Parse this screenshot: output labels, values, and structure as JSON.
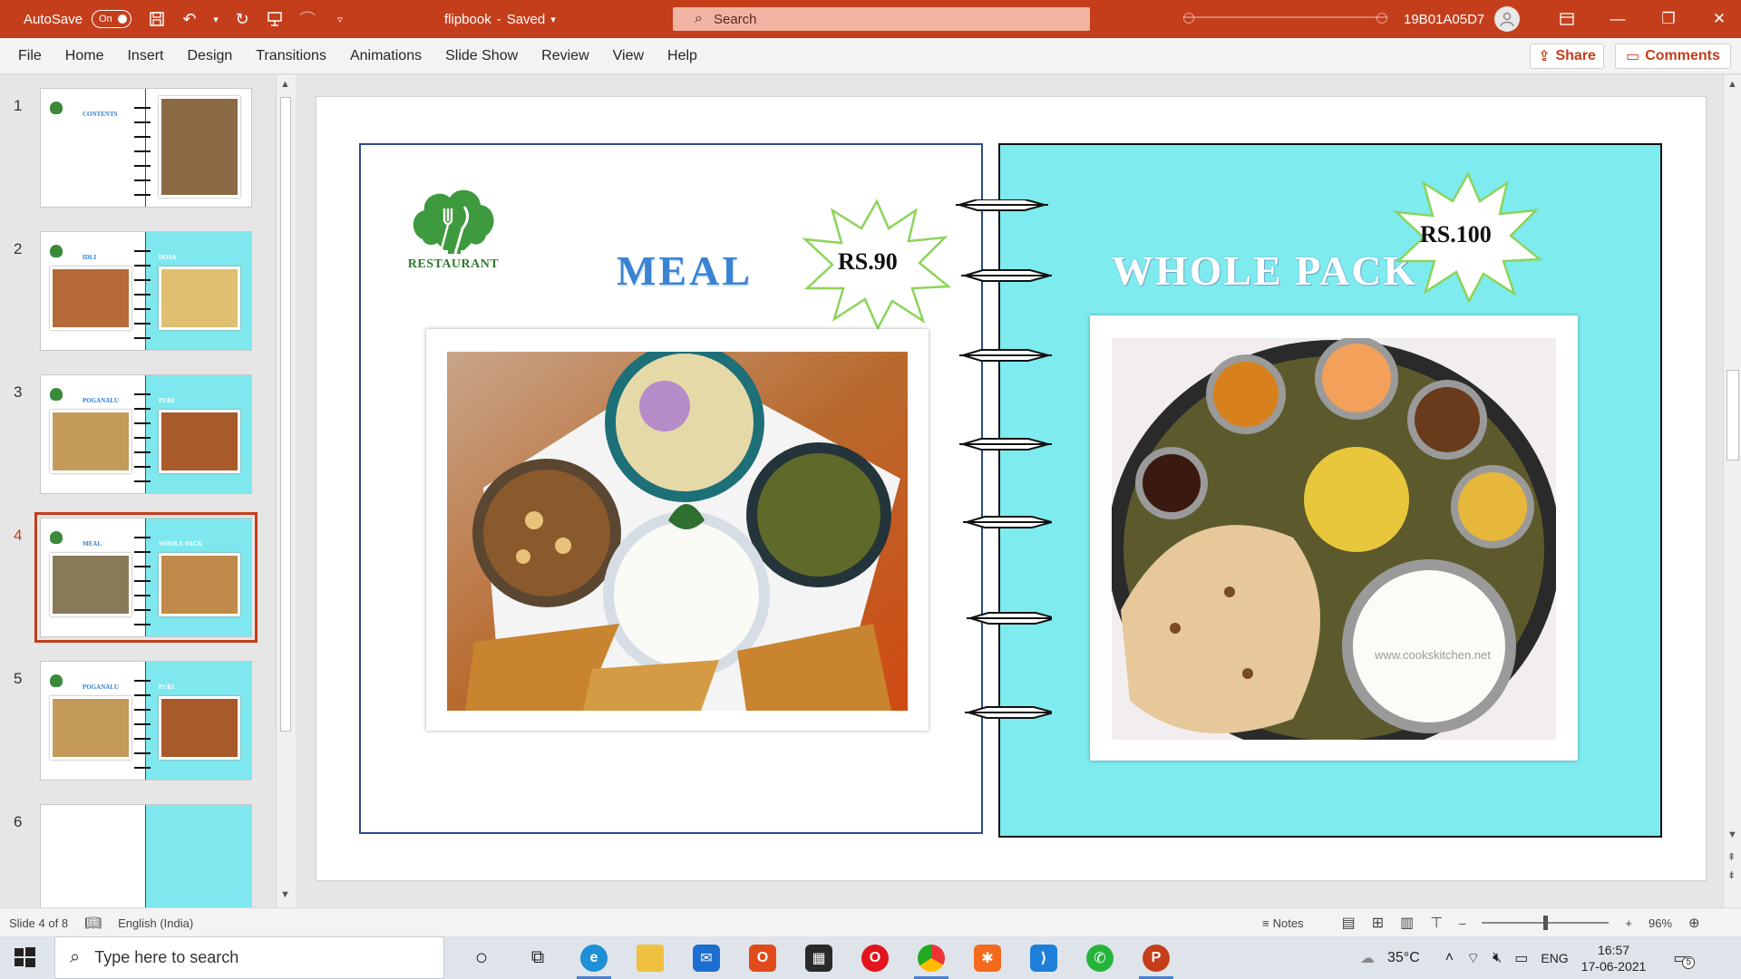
{
  "titlebar": {
    "autosave_label": "AutoSave",
    "autosave_state": "On",
    "filename": "flipbook",
    "saved_state": "Saved",
    "search_placeholder": "Search",
    "user_id": "19B01A05D7",
    "accent_color": "#c43e1c"
  },
  "menu": {
    "items": [
      "File",
      "Home",
      "Insert",
      "Design",
      "Transitions",
      "Animations",
      "Slide Show",
      "Review",
      "View",
      "Help"
    ],
    "share_label": "Share",
    "comments_label": "Comments"
  },
  "slides": [
    {
      "number": "1",
      "label_left": "CONTENTS",
      "right_color": "white"
    },
    {
      "number": "2",
      "label_left": "IDLI",
      "label_right": "DOSA",
      "right_color": "cyan"
    },
    {
      "number": "3",
      "label_left": "POGANALU",
      "label_right": "PURI",
      "right_color": "cyan"
    },
    {
      "number": "4",
      "label_left": "MEAL",
      "label_right": "WHOLE PACK",
      "right_color": "cyan",
      "active": true
    },
    {
      "number": "5",
      "label_left": "POGANALU",
      "label_right": "PURI",
      "right_color": "cyan"
    },
    {
      "number": "6",
      "right_color": "cyan"
    }
  ],
  "slide": {
    "logo_text": "RESTAURANT",
    "left_title": "MEAL",
    "left_price": "RS.90",
    "right_title": "WHOLE PACK",
    "right_price": "RS.100",
    "watermark": "www.cookskitchen.net",
    "right_bg_color": "#7eebef",
    "title_color": "#3a83d2"
  },
  "status": {
    "slide_indicator": "Slide 4 of 8",
    "language": "English (India)",
    "notes_label": "Notes",
    "zoom": "96%"
  },
  "taskbar": {
    "search_placeholder": "Type here to search",
    "weather": "35°C",
    "lang": "ENG",
    "time": "16:57",
    "date": "17-06-2021",
    "notifications": "5"
  }
}
